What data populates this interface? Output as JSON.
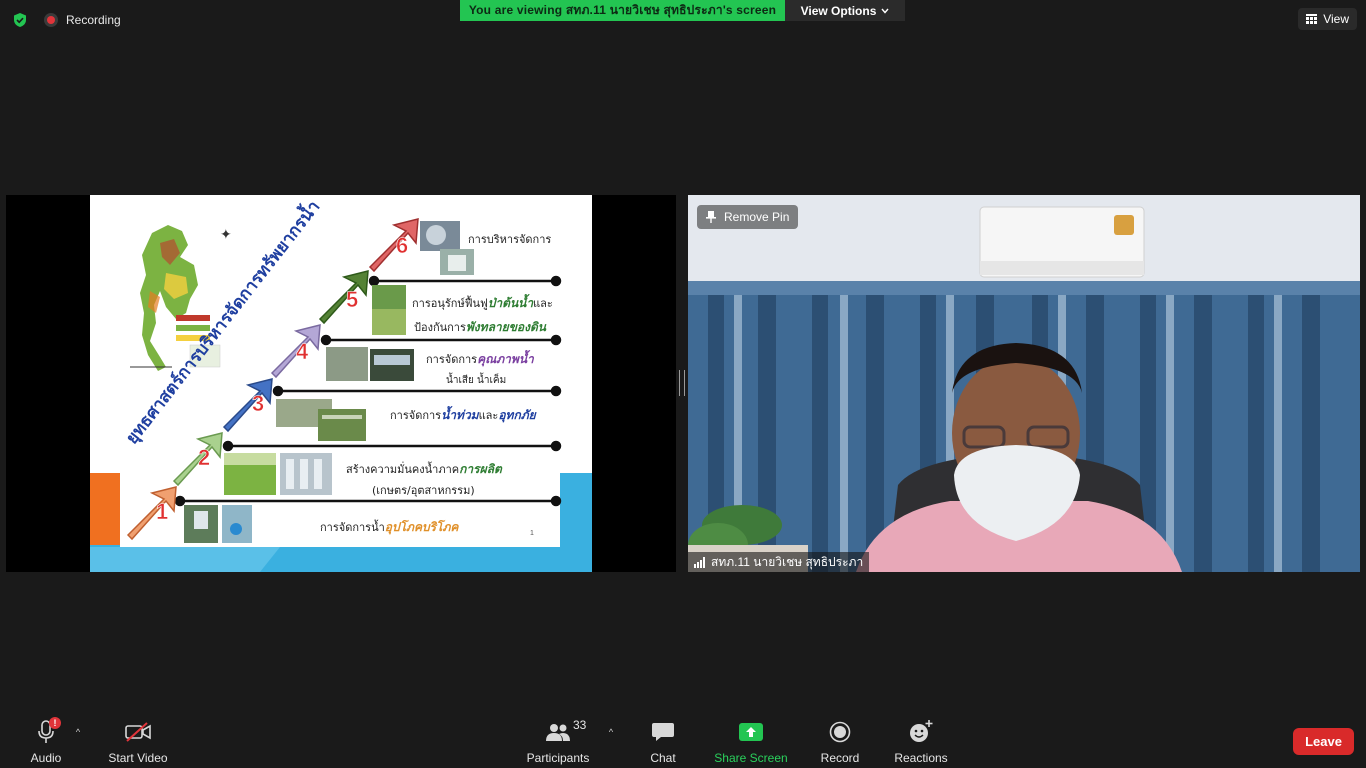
{
  "topbar": {
    "recording_label": "Recording",
    "viewing_banner": "You are viewing สทภ.11 นายวิเชษ สุทธิประภา's screen",
    "view_options_label": "View Options",
    "view_label": "View"
  },
  "slide": {
    "title": "ยุทธศาสตร์การบริหารจัดการทรัพยากรน้ำ",
    "page_number": "1",
    "steps": [
      {
        "number": "1",
        "text_plain": "การจัดการน้ำ",
        "text_emph": "อุปโภคบริโภค",
        "line2": ""
      },
      {
        "number": "2",
        "text_plain": "สร้างความมั่นคงน้ำภาค",
        "text_emph": "การผลิต",
        "line2": "(เกษตร/อุตสาหกรรม)"
      },
      {
        "number": "3",
        "text_plain": "การจัดการ",
        "text_emph": "น้ำท่วม",
        "text_plain2": "และ",
        "text_emph2": "อุทกภัย",
        "line2": ""
      },
      {
        "number": "4",
        "text_plain": "การจัดการ",
        "text_emph": "คุณภาพน้ำ",
        "line2": "น้ำเสีย  น้ำเค็ม"
      },
      {
        "number": "5",
        "text_plain": "การอนุรักษ์ฟื้นฟู",
        "text_emph": "ป่าต้นน้ำ",
        "text_plain2": "และ",
        "line2_plain": "ป้องกันการ",
        "line2_emph": "พังทลายของดิน"
      },
      {
        "number": "6",
        "text_plain": "การบริหารจัดการ",
        "text_emph": "",
        "line2": ""
      }
    ],
    "colors": {
      "step1": "#f0a070",
      "step2": "#a9d18e",
      "step3": "#4472c4",
      "step4": "#b4a7d6",
      "step5": "#548235",
      "step6": "#e06666",
      "number": "#e03030",
      "emph_orange": "#e0902a",
      "emph_purple": "#7a3fa0",
      "emph_green": "#2e7d32",
      "accent_orange": "#f07020",
      "accent_blue": "#3ab0e0"
    }
  },
  "video": {
    "remove_pin_label": "Remove Pin",
    "participant_name": "สทภ.11 นายวิเชษ สุทธิประภา"
  },
  "toolbar": {
    "audio_label": "Audio",
    "audio_badge": "!",
    "start_video_label": "Start Video",
    "participants_label": "Participants",
    "participants_count": "33",
    "chat_label": "Chat",
    "share_screen_label": "Share Screen",
    "record_label": "Record",
    "reactions_label": "Reactions",
    "leave_label": "Leave"
  },
  "colors": {
    "background": "#1a1a1a",
    "banner_green": "#23c552",
    "share_green": "#2ad05c",
    "leave_red": "#d92a2a",
    "security_green": "#23c552"
  },
  "icons": {
    "security": "shield-check-icon",
    "recording": "recording-dot-icon",
    "view_options_chevron": "chevron-down-icon",
    "view": "grid-view-icon",
    "pin": "pin-icon",
    "signal": "signal-bars-icon",
    "audio": "microphone-icon",
    "video": "video-off-icon",
    "participants": "people-icon",
    "chat": "chat-bubble-icon",
    "share": "share-screen-icon",
    "record": "record-icon",
    "reactions": "emoji-plus-icon"
  }
}
